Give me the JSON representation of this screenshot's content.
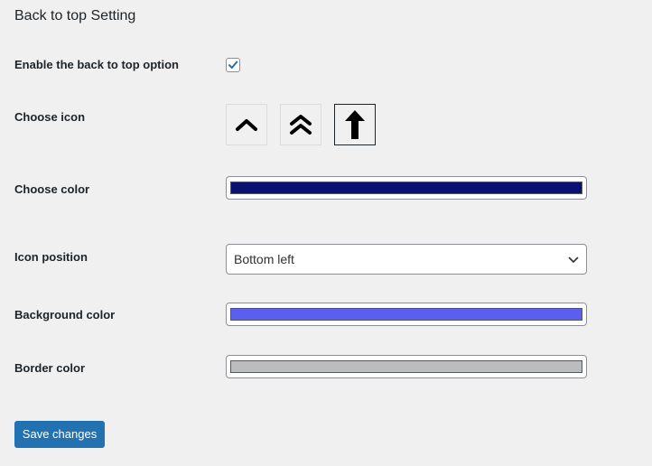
{
  "page_title": "Back to top Setting",
  "enable": {
    "label": "Enable the back to top option",
    "checked": true
  },
  "choose_icon": {
    "label": "Choose icon",
    "options": [
      {
        "icon": "chevron-up-icon",
        "selected": false
      },
      {
        "icon": "double-chevron-up-icon",
        "selected": false
      },
      {
        "icon": "arrow-up-icon",
        "selected": true
      }
    ]
  },
  "choose_color": {
    "label": "Choose color",
    "value": "#0b1170"
  },
  "icon_position": {
    "label": "Icon position",
    "selected": "Bottom left"
  },
  "background_color": {
    "label": "Background color",
    "value": "#5b5ff0"
  },
  "border_color": {
    "label": "Border color",
    "value": "#bcbcbc"
  },
  "save_button": {
    "label": "Save changes"
  },
  "colors": {
    "accent": "#2271b1"
  }
}
